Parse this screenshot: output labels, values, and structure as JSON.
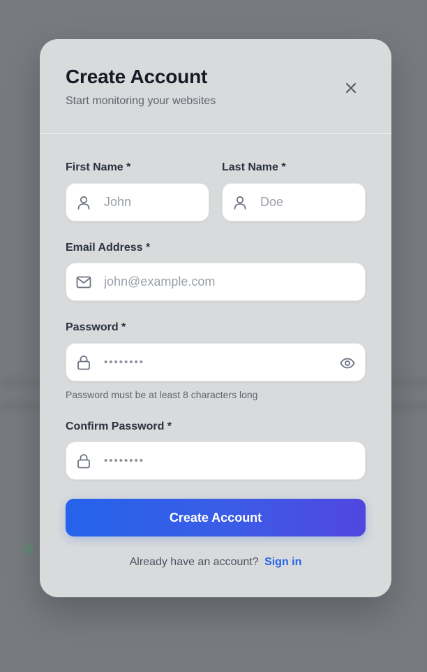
{
  "modal": {
    "title": "Create Account",
    "subtitle": "Start monitoring your websites",
    "close_icon": "close-icon"
  },
  "form": {
    "first_name": {
      "label": "First Name *",
      "placeholder": "John",
      "icon": "user-icon"
    },
    "last_name": {
      "label": "Last Name *",
      "placeholder": "Doe",
      "icon": "user-icon"
    },
    "email": {
      "label": "Email Address *",
      "placeholder": "john@example.com",
      "icon": "mail-icon"
    },
    "password": {
      "label": "Password *",
      "masked_value": "••••••••",
      "icon": "lock-icon",
      "toggle_icon": "eye-icon",
      "hint": "Password must be at least 8 characters long"
    },
    "confirm_password": {
      "label": "Confirm Password *",
      "masked_value": "••••••••",
      "icon": "lock-icon"
    },
    "submit_label": "Create Account"
  },
  "footer": {
    "prompt": "Already have an account?",
    "link_label": "Sign in"
  },
  "colors": {
    "accent": "#2563eb",
    "accent_end": "#5146e0",
    "modal_bg": "#d8dadb",
    "title": "#151a25"
  }
}
